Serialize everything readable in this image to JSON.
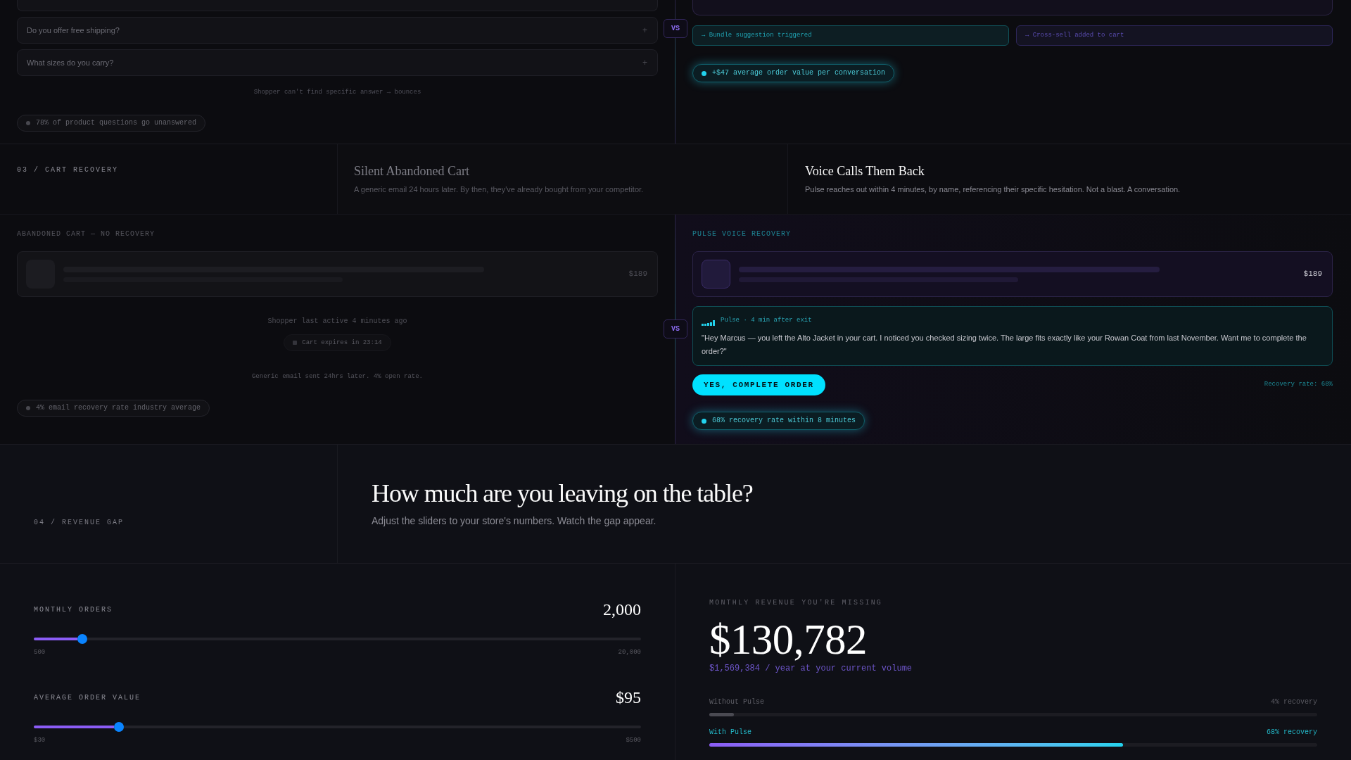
{
  "questions_section": {
    "before": {
      "faq_items": [
        {
          "question": "Do you offer free shipping?",
          "icon": "+"
        },
        {
          "question": "What sizes do you carry?",
          "icon": "+"
        }
      ],
      "note": "Shopper can't find specific answer → bounces",
      "stat": "78% of product questions go unanswered"
    },
    "vs": "VS",
    "after": {
      "events": [
        {
          "text": "→ Bundle suggestion triggered",
          "color": "#10525a"
        },
        {
          "text": "→ Cross-sell added to cart",
          "color": "#2d2659"
        }
      ],
      "stat": "+$47 average order value per conversation"
    }
  },
  "cart_recovery_section": {
    "label": "03 / CART RECOVERY",
    "before_heading": {
      "title": "Silent Abandoned Cart",
      "text": "A generic email 24 hours later. By then, they've already bought from your competitor."
    },
    "after_heading": {
      "title": "Voice Calls Them Back",
      "text": "Pulse reaches out within 4 minutes, by name, referencing their specific hesitation. Not a blast. A conversation."
    },
    "before": {
      "label": "ABANDONED CART — NO RECOVERY",
      "price": "$189",
      "activity": "Shopper last active 4 minutes ago",
      "timer": "Cart expires in 23:14",
      "note": "Generic email sent 24hrs later. 4% open rate.",
      "stat": "4% email recovery rate industry average"
    },
    "vs": "VS",
    "after": {
      "label": "PULSE VOICE RECOVERY",
      "price": "$189",
      "message": {
        "meta": "Pulse · 4 min after exit",
        "text": "\"Hey Marcus — you left the Alto Jacket in your cart. I noticed you checked sizing twice. The large fits exactly like your Rowan Coat from last November. Want me to complete the order?\""
      },
      "button": "YES, COMPLETE ORDER",
      "rate": "Recovery rate: 68%",
      "stat": "68% recovery rate within 8 minutes"
    }
  },
  "revenue_gap_section": {
    "label": "04 / REVENUE GAP",
    "title": "How much are you leaving on the table?",
    "subtitle": "Adjust the sliders to your store's numbers. Watch the gap appear.",
    "sliders": [
      {
        "label": "MONTHLY ORDERS",
        "value": "2,000",
        "min": "500",
        "max": "20,000",
        "level": 0.08
      },
      {
        "label": "AVERAGE ORDER VALUE",
        "value": "$95",
        "min": "$30",
        "max": "$500",
        "level": 0.14
      }
    ],
    "result": {
      "label": "MONTHLY REVENUE YOU'RE MISSING",
      "amount": "$130,782",
      "annual": "$1,569,384 / year at your current volume",
      "bars": [
        {
          "label": "Without Pulse",
          "reading": "4% recovery",
          "level": 0.04,
          "kind": "baseline"
        },
        {
          "label": "With Pulse",
          "reading": "68% recovery",
          "level": 0.68,
          "kind": "pulse"
        }
      ]
    }
  }
}
